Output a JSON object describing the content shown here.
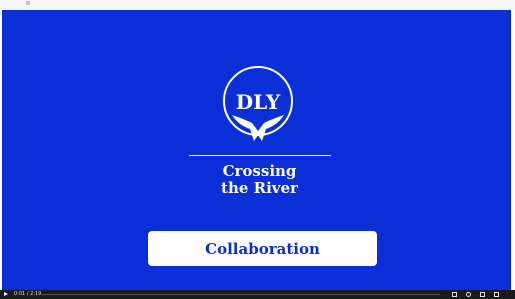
{
  "slide": {
    "logo_text": "DLY",
    "title_line1": "Crossing",
    "title_line2": "the River",
    "tag_label": "Collaboration"
  },
  "player": {
    "time": "0:01 / 2:19"
  },
  "colors": {
    "background": "#0b2fd6",
    "foreground": "#ffffff"
  },
  "icons": [
    "play-icon",
    "volume-icon",
    "settings-icon",
    "fullscreen-icon"
  ]
}
